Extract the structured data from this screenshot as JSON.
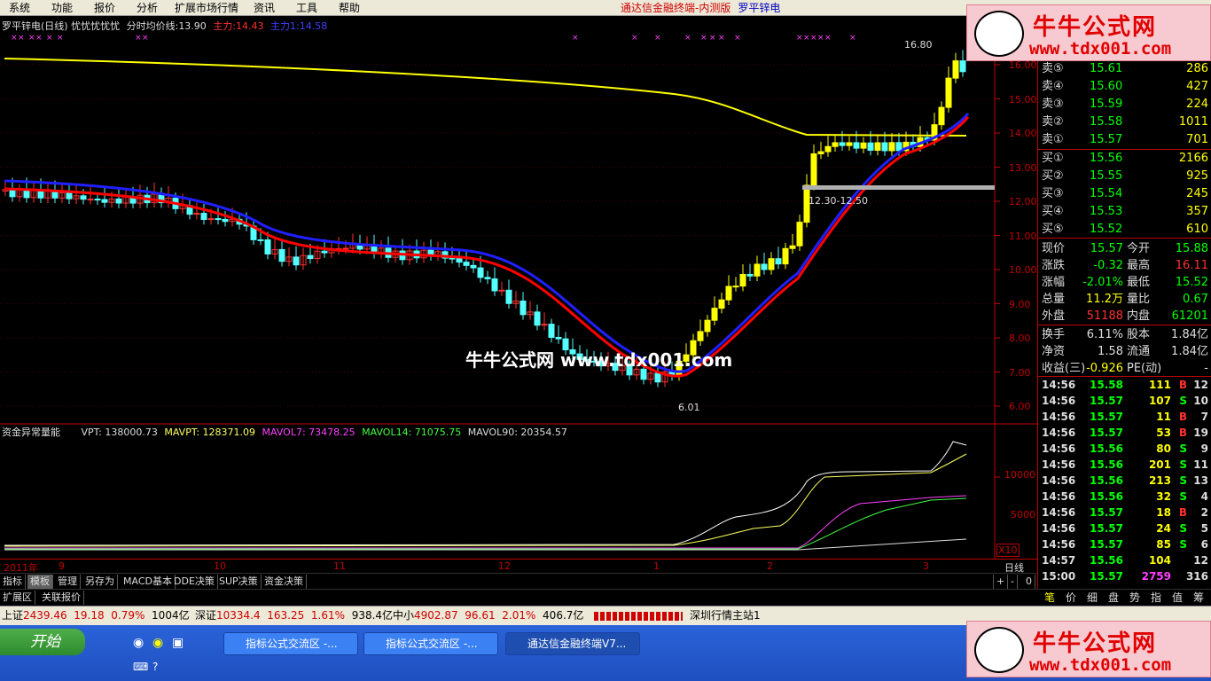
{
  "menu": {
    "items": [
      "系统",
      "功能",
      "报价",
      "分析",
      "扩展市场行情",
      "资讯",
      "工具",
      "帮助"
    ],
    "title": "通达信金融终端-内测版",
    "stock": "罗平锌电"
  },
  "chart_header": {
    "name": "罗平锌电(日线) 忧忧忧忧忧",
    "avg_label": "分时均价线:",
    "avg_value": "13.90",
    "zl_label": "主力:",
    "zl_value": "14.43",
    "zl1_label": "主力1:",
    "zl1_value": "14.58"
  },
  "annotations": {
    "high": "16.80",
    "low": "6.01",
    "range": "12.30-12.50"
  },
  "yaxis": [
    "16.00",
    "15.00",
    "14.00",
    "13.00",
    "12.00",
    "11.00",
    "10.00",
    "9.00",
    "8.00",
    "7.00",
    "6.00"
  ],
  "indicator": {
    "name": "资金异常量能",
    "vpt": "VPT: 138000.73",
    "mavpt": "MAVPT: 128371.09",
    "mavol7": "MAVOL7: 73478.25",
    "mavol14": "MAVOL14: 71075.75",
    "mavol90": "MAVOL90: 20354.57",
    "y1": "10000",
    "y2": "5000",
    "x10": "X10"
  },
  "xaxis": [
    "2011年",
    "9",
    "10",
    "11",
    "12",
    "1",
    "2",
    "3"
  ],
  "period": "日线",
  "tabs1": [
    "指标",
    "模板",
    "管理",
    "另存为",
    "MACD基本",
    "DDE决策",
    "SUP决策",
    "资金决策"
  ],
  "tabs2": [
    "扩展区",
    "关联报价"
  ],
  "tab_ctrl": [
    "+",
    "-",
    "0"
  ],
  "sells": [
    {
      "l": "卖⑤",
      "p": "15.61",
      "v": "286"
    },
    {
      "l": "卖④",
      "p": "15.60",
      "v": "427"
    },
    {
      "l": "卖③",
      "p": "15.59",
      "v": "224"
    },
    {
      "l": "卖②",
      "p": "15.58",
      "v": "1011"
    },
    {
      "l": "卖①",
      "p": "15.57",
      "v": "701"
    }
  ],
  "buys": [
    {
      "l": "买①",
      "p": "15.56",
      "v": "2166"
    },
    {
      "l": "买②",
      "p": "15.55",
      "v": "925"
    },
    {
      "l": "买③",
      "p": "15.54",
      "v": "245"
    },
    {
      "l": "买④",
      "p": "15.53",
      "v": "357"
    },
    {
      "l": "买⑤",
      "p": "15.52",
      "v": "610"
    }
  ],
  "stats": [
    {
      "a": "现价",
      "b": "15.57",
      "c": "今开",
      "d": "15.88"
    },
    {
      "a": "涨跌",
      "b": "-0.32",
      "c": "最高",
      "d": "16.11"
    },
    {
      "a": "涨幅",
      "b": "-2.01%",
      "c": "最低",
      "d": "15.52"
    },
    {
      "a": "总量",
      "b": "11.2万",
      "c": "量比",
      "d": "0.67"
    },
    {
      "a": "外盘",
      "b": "51188",
      "c": "内盘",
      "d": "61201"
    },
    {
      "a": "换手",
      "b": "6.11%",
      "c": "股本",
      "d": "1.84亿"
    },
    {
      "a": "净资",
      "b": "1.58",
      "c": "流通",
      "d": "1.84亿"
    },
    {
      "a": "收益(三)",
      "b": "-0.926",
      "c": "PE(动)",
      "d": "-"
    }
  ],
  "trades": [
    {
      "t": "14:56",
      "p": "15.58",
      "v": "111",
      "s": "B",
      "n": "12"
    },
    {
      "t": "14:56",
      "p": "15.57",
      "v": "107",
      "s": "S",
      "n": "10"
    },
    {
      "t": "14:56",
      "p": "15.57",
      "v": "11",
      "s": "B",
      "n": "7"
    },
    {
      "t": "14:56",
      "p": "15.57",
      "v": "53",
      "s": "B",
      "n": "19"
    },
    {
      "t": "14:56",
      "p": "15.56",
      "v": "80",
      "s": "S",
      "n": "9"
    },
    {
      "t": "14:56",
      "p": "15.56",
      "v": "201",
      "s": "S",
      "n": "11"
    },
    {
      "t": "14:56",
      "p": "15.56",
      "v": "213",
      "s": "S",
      "n": "13"
    },
    {
      "t": "14:56",
      "p": "15.56",
      "v": "32",
      "s": "S",
      "n": "4"
    },
    {
      "t": "14:56",
      "p": "15.57",
      "v": "18",
      "s": "B",
      "n": "2"
    },
    {
      "t": "14:56",
      "p": "15.57",
      "v": "24",
      "s": "S",
      "n": "5"
    },
    {
      "t": "14:56",
      "p": "15.57",
      "v": "85",
      "s": "S",
      "n": "6"
    },
    {
      "t": "14:57",
      "p": "15.56",
      "v": "104",
      "s": "",
      "n": "12"
    },
    {
      "t": "15:00",
      "p": "15.57",
      "v": "2759",
      "s": "",
      "n": "316"
    }
  ],
  "qtabs": [
    "笔",
    "价",
    "细",
    "盘",
    "势",
    "指",
    "值",
    "筹"
  ],
  "status": {
    "sh_label": "上证",
    "sh": "2439.46",
    "sh_chg": "19.18",
    "sh_pct": "0.79%",
    "sh_amt": "1004亿",
    "sz_label": "深证",
    "sz": "10334.4",
    "sz_chg": "163.25",
    "sz_pct": "1.61%",
    "sz_amt": "938.4亿",
    "zx_label": "中小",
    "zx": "4902.87",
    "zx_chg": "96.61",
    "zx_pct": "2.01%",
    "zx_amt": "406.7亿",
    "server": "深圳行情主站1"
  },
  "taskbar": {
    "start": "开始",
    "w1": "指标公式交流区 -...",
    "w2": "指标公式交流区 -...",
    "w3": "通达信金融终端V7..."
  },
  "watermark": {
    "text": "牛牛公式网",
    "url": "www.tdx001.com",
    "center": "牛牛公式网 www.tdx001.com"
  },
  "colors": {
    "up": "#ff3030",
    "down": "#54ffff",
    "yellow": "#ffff00",
    "ma_red": "#ff0000",
    "ma_blue": "#2020ff"
  }
}
